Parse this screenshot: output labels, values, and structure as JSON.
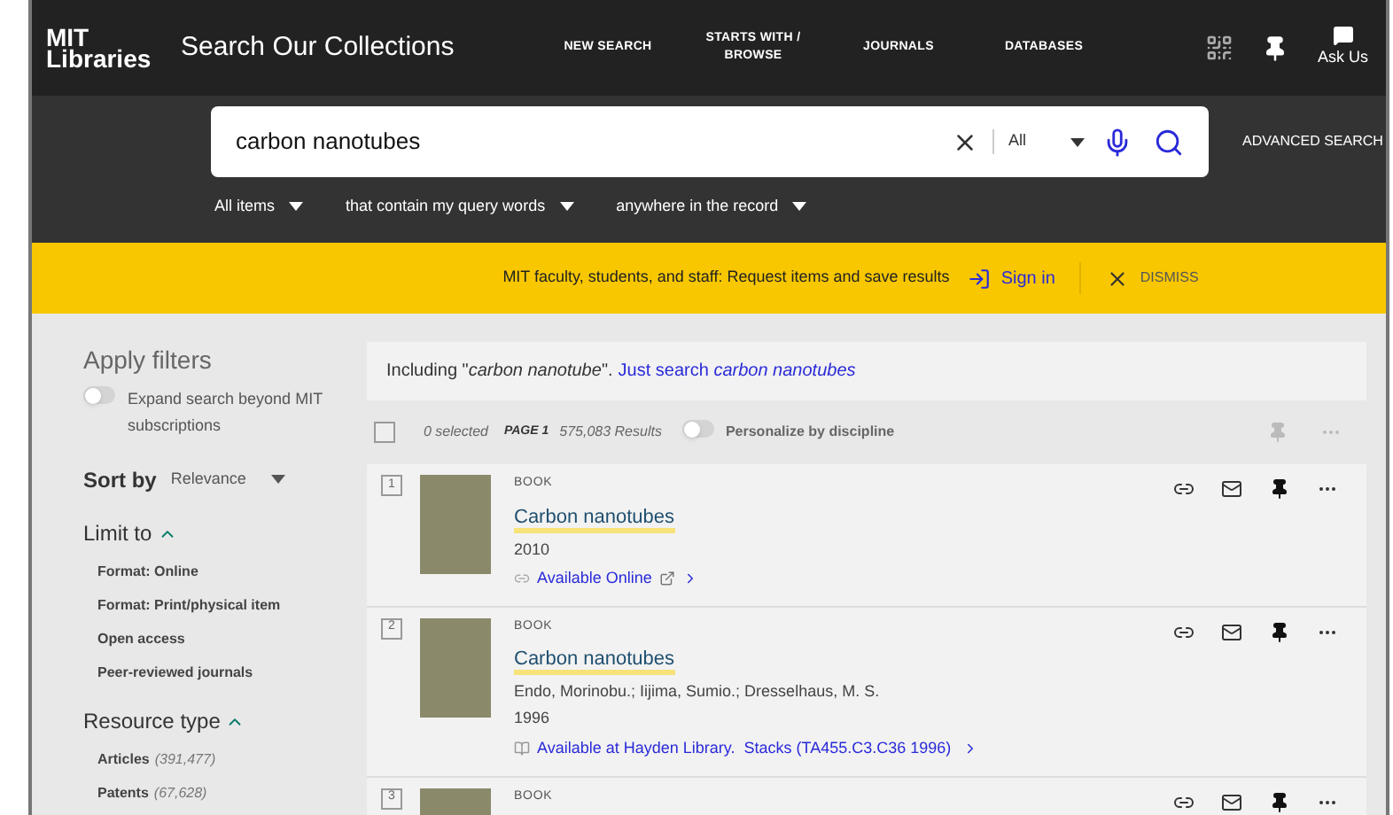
{
  "header": {
    "logo_line1": "MIT",
    "logo_line2": "Libraries",
    "title": "Search Our Collections",
    "nav": [
      "NEW SEARCH",
      "STARTS WITH / BROWSE",
      "JOURNALS",
      "DATABASES"
    ],
    "ask": "Ask Us"
  },
  "search": {
    "value": "carbon nanotubes",
    "scope": "All",
    "advanced": "ADVANCED SEARCH",
    "filters": [
      "All items",
      "that contain my query words",
      "anywhere in the record"
    ]
  },
  "banner": {
    "message": "MIT faculty, students, and staff: Request items and save results",
    "sign_in": "Sign in",
    "dismiss": "DISMISS"
  },
  "sidebar": {
    "title": "Apply filters",
    "expand": {
      "label": "Expand search beyond MIT subscriptions",
      "on": false
    },
    "sort_label": "Sort by",
    "sort_value": "Relevance",
    "sections": [
      {
        "title": "Limit to",
        "expanded": true,
        "items": [
          {
            "label": "Format: Online"
          },
          {
            "label": "Format: Print/physical item"
          },
          {
            "label": "Open access"
          },
          {
            "label": "Peer-reviewed journals"
          }
        ]
      },
      {
        "title": "Resource type",
        "expanded": true,
        "items": [
          {
            "label": "Articles",
            "count": "(391,477)"
          },
          {
            "label": "Patents",
            "count": "(67,628)"
          }
        ]
      }
    ]
  },
  "notice": {
    "text": "Including \"*carbon nanotube*\".",
    "link": "Just search *carbon nanotubes*"
  },
  "toolbar": {
    "selected": "0 selected",
    "page": "PAGE 1",
    "results": "575,083 Results",
    "personalize": {
      "label": "Personalize by discipline",
      "on": false
    },
    "select_all": false
  },
  "results": [
    {
      "index": "1",
      "type": "BOOK",
      "title": "Carbon nanotubes",
      "year": "2010",
      "availability": "Available Online",
      "kind": "online"
    },
    {
      "index": "2",
      "type": "BOOK",
      "title": "Carbon nanotubes",
      "author": "Endo, Morinobu.; Iijima, Sumio.; Dresselhaus, M. S.",
      "year": "1996",
      "availability": "Available at Hayden Library.  Stacks (TA455.C3.C36 1996)",
      "kind": "physical"
    },
    {
      "index": "3",
      "type": "BOOK",
      "kind": "none"
    }
  ]
}
